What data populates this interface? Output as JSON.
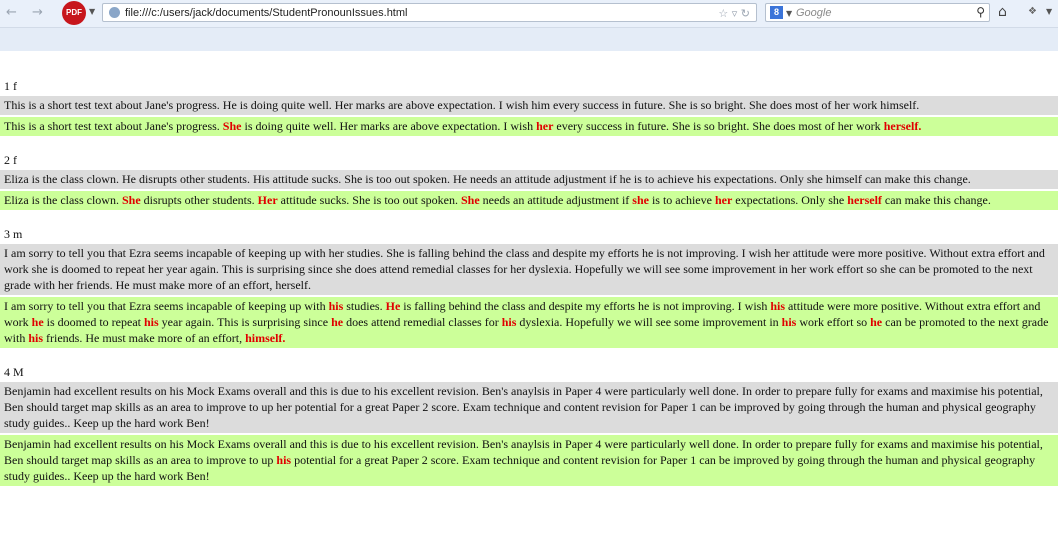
{
  "browser": {
    "pdf_label": "PDF",
    "url": "file:///c:/users/jack/documents/StudentPronounIssues.html",
    "search_placeholder": "Google",
    "engine_letter": "8"
  },
  "entries": [
    {
      "label": "1 f",
      "original": "This is a short test text about Jane's progress. He is doing quite well. Her marks are above expectation. I wish him every success in future. She is so bright. She does most of her work himself.",
      "corrected": [
        {
          "t": "This is a short test text about Jane's progress. "
        },
        {
          "t": "She",
          "h": true
        },
        {
          "t": " is doing quite well. Her marks are above expectation. I wish "
        },
        {
          "t": "her",
          "h": true
        },
        {
          "t": " every success in future. She is so bright. She does most of her work "
        },
        {
          "t": "herself.",
          "h": true
        }
      ]
    },
    {
      "label": "2 f",
      "original": "Eliza is the class clown. He disrupts other students. His attitude sucks. She is too out spoken. He needs an attitude adjustment if he is to achieve his expectations. Only she himself can make this change.",
      "corrected": [
        {
          "t": "Eliza is the class clown. "
        },
        {
          "t": "She",
          "h": true
        },
        {
          "t": " disrupts other students. "
        },
        {
          "t": "Her",
          "h": true
        },
        {
          "t": " attitude sucks. She is too out spoken. "
        },
        {
          "t": "She",
          "h": true
        },
        {
          "t": " needs an attitude adjustment if "
        },
        {
          "t": "she",
          "h": true
        },
        {
          "t": " is to achieve "
        },
        {
          "t": "her",
          "h": true
        },
        {
          "t": " expectations. Only she "
        },
        {
          "t": "herself",
          "h": true
        },
        {
          "t": " can make this change."
        }
      ]
    },
    {
      "label": "3 m",
      "original": "I am sorry to tell you that Ezra seems incapable of keeping up with her studies. She is falling behind the class and despite my efforts he is not improving. I wish her attitude were more positive. Without extra effort and work she is doomed to repeat her year again. This is surprising since she does attend remedial classes for her dyslexia. Hopefully we will see some improvement in her work effort so she can be promoted to the next grade with her friends. He must make more of an effort, herself.",
      "corrected": [
        {
          "t": "I am sorry to tell you that Ezra seems incapable of keeping up with "
        },
        {
          "t": "his",
          "h": true
        },
        {
          "t": " studies. "
        },
        {
          "t": "He",
          "h": true
        },
        {
          "t": " is falling behind the class and despite my efforts he is not improving. I wish "
        },
        {
          "t": "his",
          "h": true
        },
        {
          "t": " attitude were more positive. Without extra effort and work "
        },
        {
          "t": "he",
          "h": true
        },
        {
          "t": " is doomed to repeat "
        },
        {
          "t": "his",
          "h": true
        },
        {
          "t": " year again. This is surprising since "
        },
        {
          "t": "he",
          "h": true
        },
        {
          "t": " does attend remedial classes for "
        },
        {
          "t": "his",
          "h": true
        },
        {
          "t": " dyslexia. Hopefully we will see some improvement in "
        },
        {
          "t": "his",
          "h": true
        },
        {
          "t": " work effort so "
        },
        {
          "t": "he",
          "h": true
        },
        {
          "t": " can be promoted to the next grade with "
        },
        {
          "t": "his",
          "h": true
        },
        {
          "t": " friends. He must make more of an effort, "
        },
        {
          "t": "himself.",
          "h": true
        }
      ]
    },
    {
      "label": "4 M",
      "original": "Benjamin had excellent results on his Mock Exams overall and this is due to his excellent revision. Ben's anaylsis in Paper 4 were particularly well done. In order to prepare fully for exams and maximise his potential, Ben should target map skills as an area to improve to up her potential for a great Paper 2 score. Exam technique and content revision for Paper 1 can be improved by going through the human and physical geography study guides.. Keep up the hard work Ben!",
      "corrected": [
        {
          "t": "Benjamin had excellent results on his Mock Exams overall and this is due to his excellent revision. Ben's anaylsis in Paper 4 were particularly well done. In order to prepare fully for exams and maximise his potential, Ben should target map skills as an area to improve to up "
        },
        {
          "t": "his",
          "h": true
        },
        {
          "t": " potential for a great Paper 2 score. Exam technique and content revision for Paper 1 can be improved by going through the human and physical geography study guides.. Keep up the hard work Ben!"
        }
      ]
    }
  ]
}
